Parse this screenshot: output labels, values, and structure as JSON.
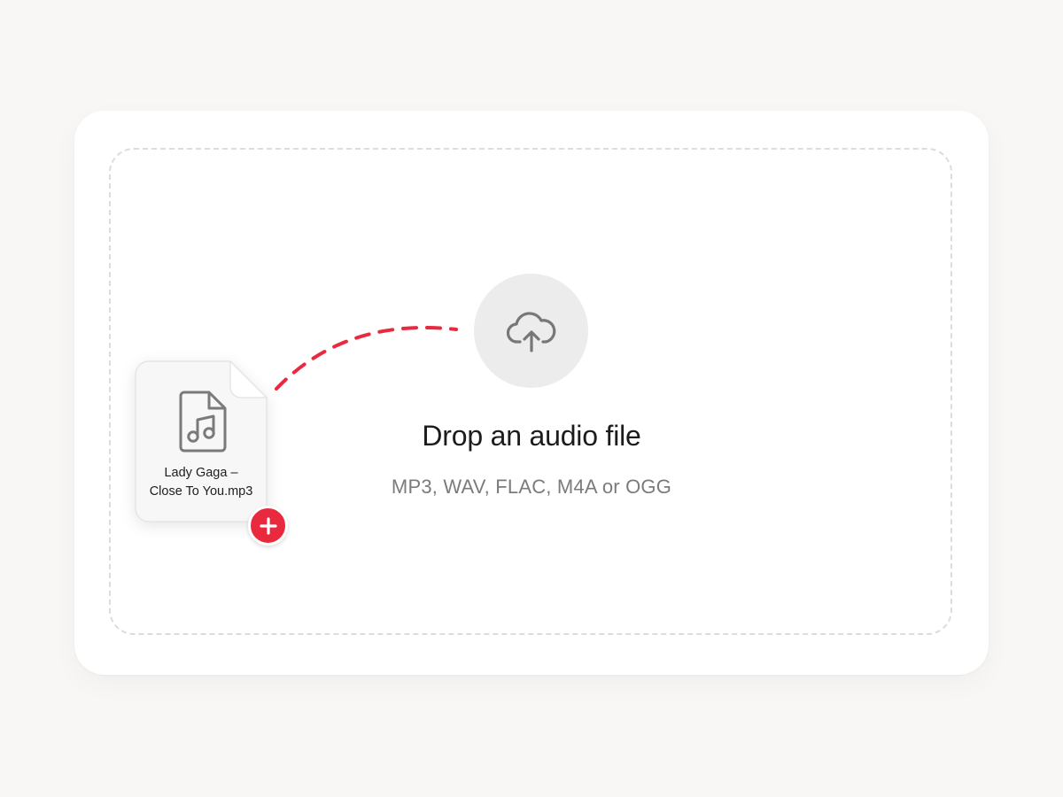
{
  "dropzone": {
    "title": "Drop an audio file",
    "formats": "MP3, WAV, FLAC, M4A or OGG",
    "upload_icon": "cloud-upload-icon"
  },
  "dragged_file": {
    "name_line1": "Lady Gaga –",
    "name_line2": "Close To You.mp3",
    "file_icon": "music-file-icon",
    "badge_icon": "plus-icon"
  },
  "colors": {
    "accent": "#e8293e",
    "background": "#f8f7f5",
    "card": "#ffffff",
    "icon": "#777777"
  }
}
